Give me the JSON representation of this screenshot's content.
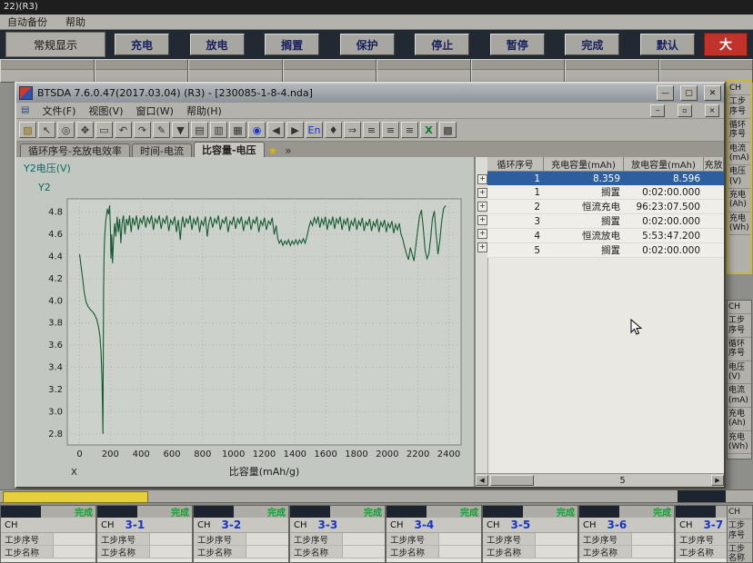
{
  "colors": {
    "accent_navy": "#18205e",
    "curve_green": "#155c32",
    "status_green": "#12a22e",
    "selection_blue": "#2d5fa0",
    "scroll_yellow": "#e6cf3c",
    "button_red": "#c1322a"
  },
  "desktop": {
    "top_title": "22)(R3)",
    "menu_items": [
      "自动备份",
      "帮助"
    ]
  },
  "control_bar": {
    "left_label": "常规显示",
    "buttons": [
      "充电",
      "放电",
      "搁置",
      "保护",
      "停止",
      "暂停",
      "完成",
      "默认"
    ],
    "big_button": "大"
  },
  "window": {
    "title": "BTSDA 7.6.0.47(2017.03.04) (R3) - [230085-1-8-4.nda]",
    "titlebar_buttons": [
      "—",
      "▢",
      "✕"
    ],
    "menus": [
      "文件(F)",
      "视图(V)",
      "窗口(W)",
      "帮助(H)"
    ],
    "menu_icon": "▤",
    "inner_buttons": [
      "‒",
      "▫",
      "×"
    ],
    "toolbar_icons": [
      {
        "name": "open-file-icon",
        "glyph": "▨"
      },
      {
        "name": "cursor-icon",
        "glyph": "↖"
      },
      {
        "name": "zoom-icon",
        "glyph": "◎"
      },
      {
        "name": "pan-icon",
        "glyph": "✥"
      },
      {
        "name": "region-select-icon",
        "glyph": "▭"
      },
      {
        "name": "undo-icon",
        "glyph": "↶"
      },
      {
        "name": "redo-icon",
        "glyph": "↷"
      },
      {
        "name": "pen-icon",
        "glyph": "✎"
      },
      {
        "name": "filter-icon",
        "glyph": "▼"
      },
      {
        "name": "folder-icon",
        "glyph": "▤"
      },
      {
        "name": "save-icon",
        "glyph": "▥"
      },
      {
        "name": "report-icon",
        "glyph": "▦"
      },
      {
        "name": "globe-icon",
        "glyph": "◉"
      },
      {
        "name": "back-icon",
        "glyph": "◀"
      },
      {
        "name": "forward-icon",
        "glyph": "▶"
      },
      {
        "name": "language-icon",
        "glyph": "En"
      },
      {
        "name": "marker-icon",
        "glyph": "♦"
      },
      {
        "name": "jump-icon",
        "glyph": "⇒"
      },
      {
        "name": "list-icon",
        "glyph": "≡"
      },
      {
        "name": "list-left-icon",
        "glyph": "≡"
      },
      {
        "name": "list-right-icon",
        "glyph": "≡"
      },
      {
        "name": "excel-export-icon",
        "glyph": "X"
      },
      {
        "name": "grid-icon",
        "glyph": "▩"
      }
    ],
    "tabs": [
      {
        "label": "循环序号-充放电效率",
        "active": false
      },
      {
        "label": "时间-电流",
        "active": false
      },
      {
        "label": "比容量-电压",
        "active": true
      }
    ],
    "tab_star": "★",
    "tab_nav": "»"
  },
  "chart_data": {
    "type": "line",
    "title": "",
    "y_axis_label": "Y2电压(V)",
    "y_corner_label": "Y2",
    "x_corner_label": "X",
    "xlabel": "比容量(mAh/g)",
    "grid": true,
    "legend_position": "none",
    "xlim": [
      -80,
      2480
    ],
    "ylim": [
      2.7,
      4.92
    ],
    "x_ticks": [
      0,
      200,
      400,
      600,
      800,
      1000,
      1200,
      1400,
      1600,
      1800,
      2000,
      2200,
      2400
    ],
    "y_ticks": [
      "4.8",
      "4.6",
      "4.4",
      "4.2",
      "4.0",
      "3.8",
      "3.6",
      "3.4",
      "3.2",
      "3.0",
      "2.8"
    ],
    "series": [
      {
        "name": "电压",
        "color": "#155c32",
        "points": [
          [
            0,
            4.42
          ],
          [
            10,
            4.31
          ],
          [
            20,
            4.2
          ],
          [
            30,
            4.08
          ],
          [
            42,
            3.99
          ],
          [
            55,
            3.95
          ],
          [
            70,
            3.92
          ],
          [
            85,
            3.9
          ],
          [
            100,
            3.87
          ],
          [
            112,
            3.83
          ],
          [
            122,
            3.77
          ],
          [
            132,
            3.68
          ],
          [
            140,
            3.52
          ],
          [
            146,
            3.28
          ],
          [
            150,
            2.95
          ],
          [
            152,
            2.8
          ],
          [
            154,
            3.55
          ],
          [
            156,
            4.1
          ],
          [
            159,
            4.4
          ],
          [
            163,
            4.58
          ],
          [
            170,
            4.72
          ],
          [
            180,
            4.83
          ],
          [
            188,
            4.78
          ],
          [
            195,
            4.86
          ],
          [
            200,
            4.66
          ],
          [
            204,
            4.38
          ],
          [
            209,
            4.6
          ],
          [
            214,
            4.34
          ],
          [
            220,
            4.52
          ],
          [
            228,
            4.7
          ],
          [
            236,
            4.58
          ],
          [
            244,
            4.76
          ],
          [
            252,
            4.62
          ],
          [
            260,
            4.74
          ],
          [
            268,
            4.52
          ],
          [
            276,
            4.7
          ],
          [
            285,
            4.77
          ],
          [
            295,
            4.6
          ],
          [
            305,
            4.74
          ],
          [
            315,
            4.68
          ],
          [
            325,
            4.77
          ],
          [
            335,
            4.62
          ],
          [
            345,
            4.75
          ],
          [
            358,
            4.68
          ],
          [
            370,
            4.77
          ],
          [
            382,
            4.64
          ],
          [
            394,
            4.74
          ],
          [
            406,
            4.7
          ],
          [
            418,
            4.77
          ],
          [
            430,
            4.66
          ],
          [
            442,
            4.75
          ],
          [
            455,
            4.7
          ],
          [
            468,
            4.77
          ],
          [
            480,
            4.64
          ],
          [
            492,
            4.74
          ],
          [
            505,
            4.7
          ],
          [
            518,
            4.77
          ],
          [
            530,
            4.65
          ],
          [
            542,
            4.74
          ],
          [
            555,
            4.7
          ],
          [
            568,
            4.77
          ],
          [
            580,
            4.63
          ],
          [
            592,
            4.73
          ],
          [
            605,
            4.69
          ],
          [
            618,
            4.76
          ],
          [
            630,
            4.62
          ],
          [
            642,
            4.73
          ],
          [
            655,
            4.55
          ],
          [
            662,
            4.68
          ],
          [
            670,
            4.76
          ],
          [
            682,
            4.66
          ],
          [
            694,
            4.74
          ],
          [
            706,
            4.7
          ],
          [
            718,
            4.77
          ],
          [
            730,
            4.64
          ],
          [
            742,
            4.74
          ],
          [
            755,
            4.69
          ],
          [
            768,
            4.76
          ],
          [
            780,
            4.62
          ],
          [
            792,
            4.72
          ],
          [
            805,
            4.68
          ],
          [
            818,
            4.76
          ],
          [
            830,
            4.58
          ],
          [
            840,
            4.7
          ],
          [
            852,
            4.76
          ],
          [
            865,
            4.66
          ],
          [
            878,
            4.74
          ],
          [
            890,
            4.7
          ],
          [
            902,
            4.77
          ],
          [
            915,
            4.64
          ],
          [
            928,
            4.73
          ],
          [
            940,
            4.7
          ],
          [
            952,
            4.76
          ],
          [
            965,
            4.62
          ],
          [
            978,
            4.72
          ],
          [
            990,
            4.69
          ],
          [
            1002,
            4.76
          ],
          [
            1015,
            4.65
          ],
          [
            1028,
            4.74
          ],
          [
            1040,
            4.7
          ],
          [
            1052,
            4.76
          ],
          [
            1065,
            4.63
          ],
          [
            1078,
            4.72
          ],
          [
            1090,
            4.69
          ],
          [
            1102,
            4.76
          ],
          [
            1115,
            4.64
          ],
          [
            1128,
            4.73
          ],
          [
            1140,
            4.7
          ],
          [
            1152,
            4.76
          ],
          [
            1165,
            4.62
          ],
          [
            1178,
            4.72
          ],
          [
            1190,
            4.68
          ],
          [
            1202,
            4.75
          ],
          [
            1215,
            4.64
          ],
          [
            1228,
            4.72
          ],
          [
            1240,
            4.69
          ],
          [
            1252,
            4.75
          ],
          [
            1265,
            4.6
          ],
          [
            1278,
            4.68
          ],
          [
            1288,
            4.56
          ],
          [
            1298,
            4.52
          ],
          [
            1310,
            4.55
          ],
          [
            1322,
            4.5
          ],
          [
            1334,
            4.54
          ],
          [
            1346,
            4.51
          ],
          [
            1358,
            4.55
          ],
          [
            1370,
            4.5
          ],
          [
            1382,
            4.54
          ],
          [
            1394,
            4.51
          ],
          [
            1406,
            4.55
          ],
          [
            1418,
            4.51
          ],
          [
            1430,
            4.55
          ],
          [
            1442,
            4.52
          ],
          [
            1454,
            4.56
          ],
          [
            1466,
            4.52
          ],
          [
            1478,
            4.58
          ],
          [
            1490,
            4.66
          ],
          [
            1502,
            4.72
          ],
          [
            1514,
            4.68
          ],
          [
            1526,
            4.75
          ],
          [
            1538,
            4.7
          ],
          [
            1550,
            4.76
          ],
          [
            1562,
            4.66
          ],
          [
            1574,
            4.74
          ],
          [
            1586,
            4.69
          ],
          [
            1598,
            4.76
          ],
          [
            1610,
            4.64
          ],
          [
            1622,
            4.73
          ],
          [
            1634,
            4.69
          ],
          [
            1646,
            4.76
          ],
          [
            1658,
            4.65
          ],
          [
            1670,
            4.74
          ],
          [
            1682,
            4.7
          ],
          [
            1694,
            4.76
          ],
          [
            1706,
            4.64
          ],
          [
            1718,
            4.73
          ],
          [
            1730,
            4.69
          ],
          [
            1742,
            4.75
          ],
          [
            1754,
            4.63
          ],
          [
            1766,
            4.72
          ],
          [
            1778,
            4.68
          ],
          [
            1790,
            4.75
          ],
          [
            1802,
            4.64
          ],
          [
            1814,
            4.72
          ],
          [
            1826,
            4.68
          ],
          [
            1838,
            4.75
          ],
          [
            1850,
            4.63
          ],
          [
            1862,
            4.71
          ],
          [
            1874,
            4.68
          ],
          [
            1886,
            4.74
          ],
          [
            1898,
            4.63
          ],
          [
            1910,
            4.71
          ],
          [
            1922,
            4.67
          ],
          [
            1934,
            4.74
          ],
          [
            1946,
            4.62
          ],
          [
            1958,
            4.71
          ],
          [
            1970,
            4.67
          ],
          [
            1982,
            4.73
          ],
          [
            1994,
            4.62
          ],
          [
            2006,
            4.7
          ],
          [
            2018,
            4.66
          ],
          [
            2030,
            4.72
          ],
          [
            2042,
            4.61
          ],
          [
            2054,
            4.69
          ],
          [
            2066,
            4.64
          ],
          [
            2078,
            4.7
          ],
          [
            2090,
            4.6
          ],
          [
            2102,
            4.55
          ],
          [
            2114,
            4.48
          ],
          [
            2126,
            4.42
          ],
          [
            2138,
            4.37
          ],
          [
            2150,
            4.48
          ],
          [
            2162,
            4.42
          ],
          [
            2174,
            4.36
          ],
          [
            2186,
            4.5
          ],
          [
            2198,
            4.64
          ],
          [
            2210,
            4.76
          ],
          [
            2222,
            4.82
          ],
          [
            2234,
            4.66
          ],
          [
            2246,
            4.46
          ],
          [
            2258,
            4.38
          ],
          [
            2270,
            4.42
          ],
          [
            2282,
            4.56
          ],
          [
            2294,
            4.74
          ],
          [
            2306,
            4.81
          ],
          [
            2318,
            4.6
          ],
          [
            2330,
            4.42
          ],
          [
            2342,
            4.55
          ],
          [
            2354,
            4.72
          ],
          [
            2366,
            4.83
          ],
          [
            2380,
            4.86
          ]
        ]
      }
    ]
  },
  "table": {
    "headers": [
      "循环序号",
      "充电容量(mAh)",
      "放电容量(mAh)",
      "充放"
    ],
    "cycle_row": {
      "cycle": "1",
      "charge_capacity": "8.359",
      "discharge_capacity": "8.596"
    },
    "step_rows": [
      {
        "step": "1",
        "name": "搁置",
        "time": "0:02:00.000"
      },
      {
        "step": "2",
        "name": "恒流充电",
        "time": "96:23:07.500"
      },
      {
        "step": "3",
        "name": "搁置",
        "time": "0:02:00.000"
      },
      {
        "step": "4",
        "name": "恒流放电",
        "time": "5:53:47.200"
      },
      {
        "step": "5",
        "name": "搁置",
        "time": "0:02:00.000"
      }
    ],
    "hscroll_label": "5"
  },
  "right_panels": {
    "top_items": [
      "CH",
      "工步序号",
      "循环序号",
      "电流(mA)",
      "电压(V)",
      "充电(Ah)",
      "充电(Wh)"
    ],
    "mid_items": [
      "CH",
      "工步序号",
      "循环序号",
      "电压(V)",
      "电流(mA)",
      "充电(Ah)",
      "充电(Wh)"
    ],
    "corner_items": [
      "CH",
      "工步序号",
      "工步名称"
    ]
  },
  "bottom_grid": {
    "status_label": "完成",
    "ch_label": "CH",
    "channels": [
      "",
      "3-1",
      "3-2",
      "3-3",
      "3-4",
      "3-5",
      "3-6",
      "3-7"
    ],
    "row_labels": [
      "工步序号",
      "工步名称"
    ]
  }
}
